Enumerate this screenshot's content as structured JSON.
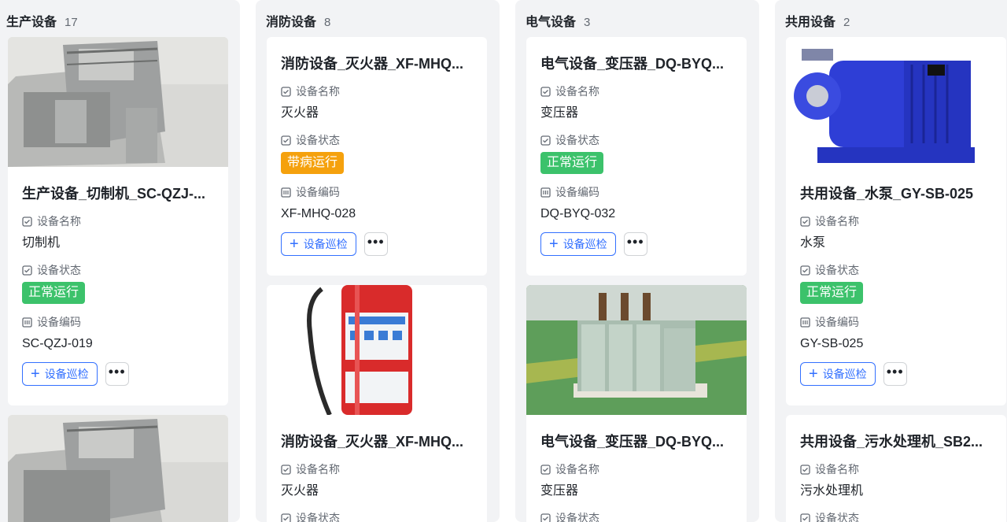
{
  "columns": [
    {
      "title": "生产设备",
      "count": "17",
      "cards": [
        {
          "image": "cutting-machine",
          "title": "生产设备_切制机_SC-QZJ-...",
          "name_label": "设备名称",
          "name": "切制机",
          "status_label": "设备状态",
          "status": "正常运行",
          "status_color": "#3cc26b",
          "code_label": "设备编码",
          "code": "SC-QZJ-019",
          "inspect_label": "设备巡检",
          "more_label": "•••"
        },
        {
          "image": "cutting-machine"
        }
      ]
    },
    {
      "title": "消防设备",
      "count": "8",
      "cards": [
        {
          "title": "消防设备_灭火器_XF-MHQ...",
          "name_label": "设备名称",
          "name": "灭火器",
          "status_label": "设备状态",
          "status": "带病运行",
          "status_color": "#f5a10d",
          "code_label": "设备编码",
          "code": "XF-MHQ-028",
          "inspect_label": "设备巡检",
          "more_label": "•••"
        },
        {
          "image": "fire-extinguisher",
          "title": "消防设备_灭火器_XF-MHQ...",
          "name_label": "设备名称",
          "name": "灭火器",
          "status_label": "设备状态"
        }
      ]
    },
    {
      "title": "电气设备",
      "count": "3",
      "cards": [
        {
          "title": "电气设备_变压器_DQ-BYQ...",
          "name_label": "设备名称",
          "name": "变压器",
          "status_label": "设备状态",
          "status": "正常运行",
          "status_color": "#3cc26b",
          "code_label": "设备编码",
          "code": "DQ-BYQ-032",
          "inspect_label": "设备巡检",
          "more_label": "•••"
        },
        {
          "image": "transformer",
          "title": "电气设备_变压器_DQ-BYQ...",
          "name_label": "设备名称",
          "name": "变压器",
          "status_label": "设备状态"
        }
      ]
    },
    {
      "title": "共用设备",
      "count": "2",
      "cards": [
        {
          "image": "water-pump",
          "title": "共用设备_水泵_GY-SB-025",
          "name_label": "设备名称",
          "name": "水泵",
          "status_label": "设备状态",
          "status": "正常运行",
          "status_color": "#3cc26b",
          "code_label": "设备编码",
          "code": "GY-SB-025",
          "inspect_label": "设备巡检",
          "more_label": "•••"
        },
        {
          "title": "共用设备_污水处理机_SB2...",
          "name_label": "设备名称",
          "name": "污水处理机",
          "status_label": "设备状态"
        }
      ]
    }
  ]
}
